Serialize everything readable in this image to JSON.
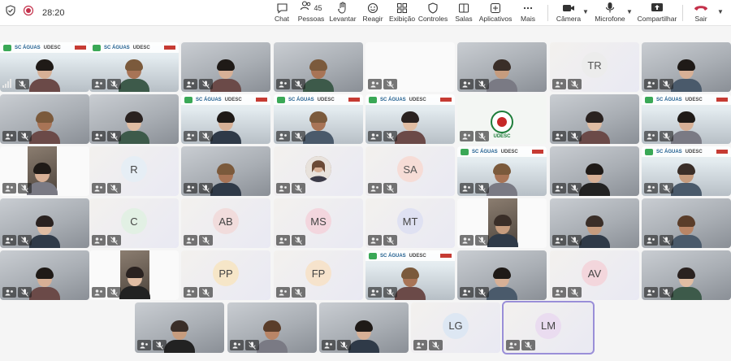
{
  "toolbar": {
    "timer": "28:20",
    "people_count": "45",
    "buttons": {
      "chat": "Chat",
      "people": "Pessoas",
      "raise": "Levantar",
      "react": "Reagir",
      "view": "Exibição",
      "controls": "Controles",
      "rooms": "Salas",
      "apps": "Aplicativos",
      "more": "Mais",
      "camera": "Câmera",
      "mic": "Microfone",
      "share": "Compartilhar",
      "leave": "Sair"
    }
  },
  "banner": {
    "sc": "SC ÁGUAS",
    "udesc": "UDESC",
    "saude": "SAÚDE 30"
  },
  "participants": {
    "r2c1": "TR",
    "r3c1": "R",
    "r3c4": "SA",
    "r4c1": "C",
    "r4c2": "AB",
    "r4c3": "MS",
    "r4c4": "MT",
    "r5c2": "PP",
    "r5c3": "FP",
    "r5c6": "AV",
    "r6c4": "LG",
    "r6c5": "LM"
  },
  "colors": {
    "accent": "#5b5fc7",
    "leave": "#c4314b",
    "record": "#c4314b",
    "selection": "#9a8fd8"
  }
}
